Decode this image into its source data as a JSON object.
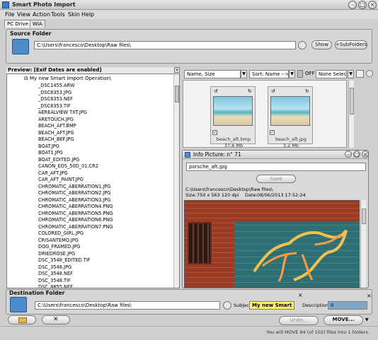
{
  "window": {
    "title": "Smart Photo Import"
  },
  "menu": [
    "File",
    "View",
    "Action",
    "Tools",
    "Skin",
    "Help"
  ],
  "tabs": [
    "PC Drive",
    "WIA"
  ],
  "source": {
    "label": "Source Folder",
    "path": "C:\\Users\\francesco\\Desktop\\Raw files\\",
    "show_label": "Show",
    "subfolders_label": "+SubFolders"
  },
  "preview": {
    "header": "Preview: [Exif Dates are enabled]",
    "operation": "My new Smart Import Operation\\",
    "files": [
      "_DSC1455.ARW",
      "_DSC8353.JPG",
      "_DSC8353.NEF",
      "_DSC8353.TIF",
      "AEREALVIEW TXT.JPG",
      "ARETOUCH.JPG",
      "BEACH_AFT.BMP",
      "BEACH_AFT.JPG",
      "BEACH_BEF.JPG",
      "BOAT.JPG",
      "BOAT1.JPG",
      "BOAT_EDITED.JPG",
      "CANON_EOS_50D_01.CR2",
      "CAR_AFT.JPG",
      "CAR_AFT_PAINT.JPG",
      "CHROMATIC_ABERRATION1.JPG",
      "CHROMATIC_ABERRATION2.JPG",
      "CHROMATIC_ABERRATION3.JPG",
      "CHROMATIC_ABERRATION4.PNG",
      "CHROMATIC_ABERRATION5.PNG",
      "CHROMATIC_ABERRATION6.PNG",
      "CHROMATIC_ABERRATION7.PNG",
      "COLORED_GIRL.JPG",
      "CRISANTEMO.JPG",
      "DOG_FRAMED.JPG",
      "DRIEDROSE.JPG",
      "DSC_3548_EDITED.TIF",
      "DSC_3548.JPG",
      "DSC_3548.NEF",
      "DSC_3548.TIF",
      "DSC_8855.NEF"
    ]
  },
  "sort": {
    "field": "Name, Size",
    "order": "Sort: Name -->",
    "off_label": "OFF",
    "selection": "None Selected"
  },
  "thumbs": [
    {
      "name": "beach_aft.bmp",
      "size": "37,6 Mb"
    },
    {
      "name": "beach_aft.jpg",
      "size": "3,2 Mb"
    }
  ],
  "info": {
    "title": "Info Picture: n° 71",
    "filename": "porsche_aft.jpg",
    "save_label": "Save",
    "path": "C:\\Users\\francesco\\Desktop\\Raw files\\",
    "size_label": "Size:",
    "size": "750 x 563 120 dpi",
    "date_label": "Date:",
    "date": "08/06/2013 17:52:24"
  },
  "destination": {
    "label": "Destination Folder",
    "path": "C:\\Users\\francesco\\Desktop\\Raw files\\",
    "subject_label": "Subject",
    "subject": "My new Smart Imp",
    "description_label": "Description",
    "description": "II"
  },
  "actions": {
    "undo_label": "Undo...",
    "move_label": "MOVE..."
  },
  "status": "You will MOVE 94 (of 102) files into 1 folders."
}
